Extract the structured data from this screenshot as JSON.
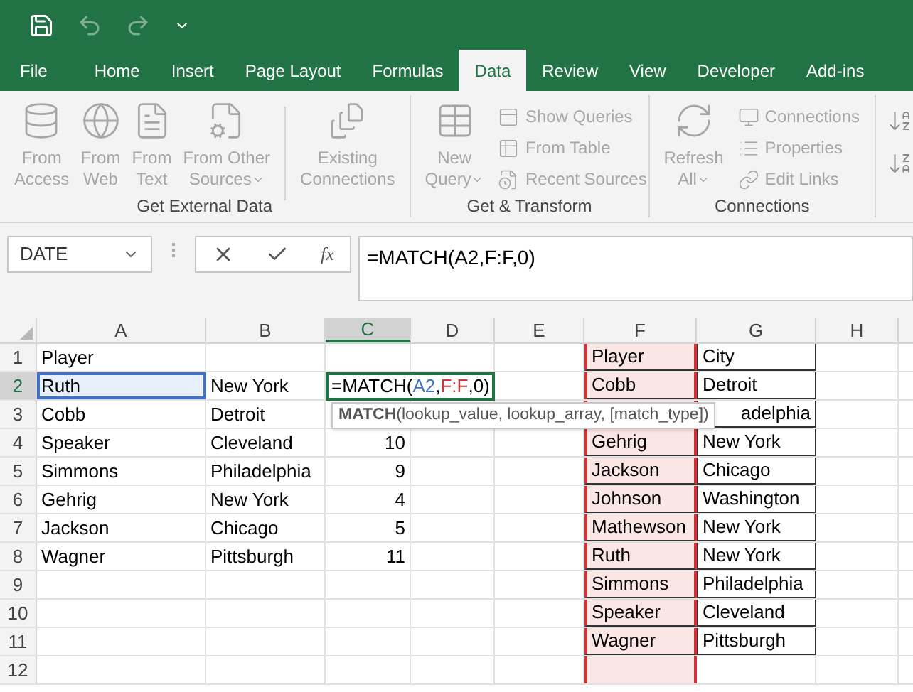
{
  "quick_access": [
    {
      "kind": "save",
      "disabled": false
    },
    {
      "kind": "undo",
      "disabled": true
    },
    {
      "kind": "redo",
      "disabled": true
    },
    {
      "kind": "customize",
      "disabled": false
    }
  ],
  "tabs": [
    {
      "label": "File",
      "selected": false
    },
    {
      "label": "Home",
      "selected": false
    },
    {
      "label": "Insert",
      "selected": false
    },
    {
      "label": "Page Layout",
      "selected": false
    },
    {
      "label": "Formulas",
      "selected": false
    },
    {
      "label": "Data",
      "selected": true
    },
    {
      "label": "Review",
      "selected": false
    },
    {
      "label": "View",
      "selected": false
    },
    {
      "label": "Developer",
      "selected": false
    },
    {
      "label": "Add-ins",
      "selected": false
    }
  ],
  "ribbon": {
    "groups": [
      {
        "label": "Get External Data",
        "buttons": [
          {
            "kind": "large",
            "lines": [
              "From",
              "Access"
            ],
            "dropdown": false,
            "disabled": true
          },
          {
            "kind": "large",
            "lines": [
              "From",
              "Web"
            ],
            "dropdown": false,
            "disabled": true
          },
          {
            "kind": "large",
            "lines": [
              "From",
              "Text"
            ],
            "dropdown": false,
            "disabled": true
          },
          {
            "kind": "large",
            "lines": [
              "From Other",
              "Sources"
            ],
            "dropdown": true,
            "disabled": true
          },
          {
            "kind": "separator"
          },
          {
            "kind": "large",
            "lines": [
              "Existing",
              "Connections"
            ],
            "dropdown": false,
            "disabled": true
          }
        ]
      },
      {
        "label": "Get & Transform",
        "buttons": [
          {
            "kind": "large",
            "lines": [
              "New",
              "Query"
            ],
            "dropdown": true,
            "disabled": true
          },
          {
            "kind": "small",
            "lines": [
              "Show Queries"
            ],
            "disabled": true
          },
          {
            "kind": "small",
            "lines": [
              "From Table"
            ],
            "disabled": true
          },
          {
            "kind": "small",
            "lines": [
              "Recent Sources"
            ],
            "disabled": true
          }
        ]
      },
      {
        "label": "Connections",
        "buttons": [
          {
            "kind": "large",
            "lines": [
              "Refresh",
              "All"
            ],
            "dropdown": true,
            "disabled": true
          },
          {
            "kind": "small",
            "lines": [
              "Connections"
            ],
            "disabled": true
          },
          {
            "kind": "small",
            "lines": [
              "Properties"
            ],
            "disabled": true
          },
          {
            "kind": "small",
            "lines": [
              "Edit Links"
            ],
            "disabled": true
          }
        ]
      }
    ]
  },
  "formula_bar": {
    "name_box": "DATE",
    "function_label": "fx",
    "formula": "=MATCH(A2,F:F,0)"
  },
  "sheet": {
    "columns": [
      {
        "label": "A",
        "selected": false
      },
      {
        "label": "B",
        "selected": false
      },
      {
        "label": "C",
        "selected": true
      },
      {
        "label": "D",
        "selected": false
      },
      {
        "label": "E",
        "selected": false
      },
      {
        "label": "F",
        "selected": false,
        "color": "#d13438"
      },
      {
        "label": "G",
        "selected": false
      },
      {
        "label": "H",
        "selected": false
      }
    ],
    "rows": [
      {
        "label": "1",
        "selected": false,
        "cells": [
          {
            "kind": "text",
            "text": "Player"
          },
          "",
          "",
          "",
          "",
          {
            "kind": "table",
            "text": "Player"
          },
          {
            "kind": "table",
            "text": "City"
          },
          ""
        ]
      },
      {
        "label": "2",
        "selected": true,
        "cells": [
          {
            "kind": "text",
            "text": "Ruth",
            "referenced": true,
            "color": "#4472c4"
          },
          {
            "kind": "text",
            "text": "New York"
          },
          {
            "kind": "formula",
            "active": true,
            "parts": [
              {
                "text": "=MATCH(",
                "color": "#000000"
              },
              {
                "text": "A2",
                "color": "#4472c4"
              },
              {
                "text": ",",
                "color": "#000000"
              },
              {
                "text": "F:F",
                "color": "#d13438"
              },
              {
                "text": ",0)",
                "color": "#000000"
              }
            ]
          },
          "",
          "",
          {
            "kind": "table",
            "text": "Cobb"
          },
          {
            "kind": "table",
            "text": "Detroit"
          },
          ""
        ]
      },
      {
        "label": "3",
        "selected": false,
        "cells": [
          {
            "kind": "text",
            "text": "Cobb"
          },
          {
            "kind": "text",
            "text": "Detroit"
          },
          "",
          "",
          "",
          "",
          {
            "kind": "table_clipped",
            "text": "adelphia"
          },
          ""
        ]
      },
      {
        "label": "4",
        "selected": false,
        "cells": [
          {
            "kind": "text",
            "text": "Speaker"
          },
          {
            "kind": "text",
            "text": "Cleveland"
          },
          {
            "kind": "number",
            "text": "10"
          },
          "",
          "",
          {
            "kind": "table",
            "text": "Gehrig"
          },
          {
            "kind": "table",
            "text": "New York"
          },
          ""
        ]
      },
      {
        "label": "5",
        "selected": false,
        "cells": [
          {
            "kind": "text",
            "text": "Simmons"
          },
          {
            "kind": "text",
            "text": "Philadelphia"
          },
          {
            "kind": "number",
            "text": "9"
          },
          "",
          "",
          {
            "kind": "table",
            "text": "Jackson"
          },
          {
            "kind": "table",
            "text": "Chicago"
          },
          ""
        ]
      },
      {
        "label": "6",
        "selected": false,
        "cells": [
          {
            "kind": "text",
            "text": "Gehrig"
          },
          {
            "kind": "text",
            "text": "New York"
          },
          {
            "kind": "number",
            "text": "4"
          },
          "",
          "",
          {
            "kind": "table",
            "text": "Johnson"
          },
          {
            "kind": "table",
            "text": "Washington"
          },
          ""
        ]
      },
      {
        "label": "7",
        "selected": false,
        "cells": [
          {
            "kind": "text",
            "text": "Jackson"
          },
          {
            "kind": "text",
            "text": "Chicago"
          },
          {
            "kind": "number",
            "text": "5"
          },
          "",
          "",
          {
            "kind": "table",
            "text": "Mathewson"
          },
          {
            "kind": "table",
            "text": "New York"
          },
          ""
        ]
      },
      {
        "label": "8",
        "selected": false,
        "cells": [
          {
            "kind": "text",
            "text": "Wagner"
          },
          {
            "kind": "text",
            "text": "Pittsburgh"
          },
          {
            "kind": "number",
            "text": "11"
          },
          "",
          "",
          {
            "kind": "table",
            "text": "Ruth"
          },
          {
            "kind": "table",
            "text": "New York"
          },
          ""
        ]
      },
      {
        "label": "9",
        "selected": false,
        "cells": [
          "",
          "",
          "",
          "",
          "",
          {
            "kind": "table",
            "text": "Simmons"
          },
          {
            "kind": "table",
            "text": "Philadelphia"
          },
          ""
        ]
      },
      {
        "label": "10",
        "selected": false,
        "cells": [
          "",
          "",
          "",
          "",
          "",
          {
            "kind": "table",
            "text": "Speaker"
          },
          {
            "kind": "table",
            "text": "Cleveland"
          },
          ""
        ]
      },
      {
        "label": "11",
        "selected": false,
        "cells": [
          "",
          "",
          "",
          "",
          "",
          {
            "kind": "table",
            "text": "Wagner"
          },
          {
            "kind": "table",
            "text": "Pittsburgh"
          },
          ""
        ]
      },
      {
        "label": "12",
        "selected": false,
        "cells": [
          "",
          "",
          "",
          "",
          "",
          "",
          "",
          ""
        ]
      }
    ],
    "tooltip": "**MATCH**(lookup_value, lookup_array, [match_type])"
  }
}
